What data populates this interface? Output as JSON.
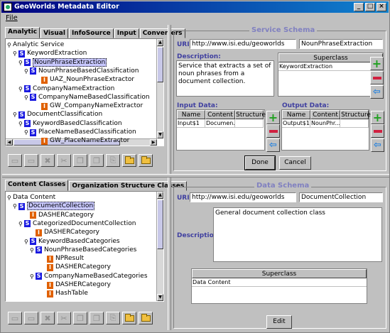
{
  "window": {
    "title": "GeoWorlds Metadata Editor"
  },
  "menu": {
    "file": "File"
  },
  "top_tabs": [
    "Analytic",
    "Visual",
    "InfoSource",
    "Input",
    "Converters"
  ],
  "top_tree": [
    {
      "type": "root",
      "label": "Analytic Service"
    },
    {
      "type": "S",
      "label": "KeywordExtraction"
    },
    {
      "type": "S",
      "label": "NounPhraseExtraction",
      "selected": true
    },
    {
      "type": "S",
      "label": "NounPhraseBasedClassification"
    },
    {
      "type": "I",
      "label": "UAZ_NounPhraseExtractor"
    },
    {
      "type": "S",
      "label": "CompanyNameExtraction"
    },
    {
      "type": "S",
      "label": "CompanyNameBasedClassification"
    },
    {
      "type": "I",
      "label": "GW_CompanyNameExtractor"
    },
    {
      "type": "S",
      "label": "DocumentClassification"
    },
    {
      "type": "S",
      "label": "KeywordBasedClassification"
    },
    {
      "type": "S",
      "label": "PlaceNameBasedClassification"
    },
    {
      "type": "I",
      "label": "GW_PlaceNameExtractor"
    }
  ],
  "bottom_tabs": [
    "Content Classes",
    "Organization Structure Classes"
  ],
  "bottom_tree": [
    {
      "type": "root",
      "label": "Data Content"
    },
    {
      "type": "S",
      "label": "DocumentCollection",
      "selected": true
    },
    {
      "type": "I",
      "label": "DASHERCategory"
    },
    {
      "type": "S",
      "label": "CategorizedDocumentCollection"
    },
    {
      "type": "I",
      "label": "DASHERCategory"
    },
    {
      "type": "S",
      "label": "KeywordBasedCategories"
    },
    {
      "type": "S",
      "label": "NounPhraseBasedCategories"
    },
    {
      "type": "I",
      "label": "NPResult"
    },
    {
      "type": "I",
      "label": "DASHERCategory"
    },
    {
      "type": "S",
      "label": "CompanyNameBasedCategories"
    },
    {
      "type": "I",
      "label": "DASHERCategory"
    },
    {
      "type": "I",
      "label": "HashTable"
    }
  ],
  "service_schema": {
    "title": "Service Schema",
    "uri_label": "URI:",
    "uri_value": "http://www.isi.edu/geoworlds",
    "name_value": "NounPhraseExtraction",
    "description_label": "Description:",
    "description": "Service that extracts a set of noun phrases from a document collection.",
    "superclass_header": "Superclass",
    "superclass_value": "KeywordExtraction",
    "input_label": "Input Data:",
    "output_label": "Output Data:",
    "columns": [
      "Name",
      "Content",
      "Structure"
    ],
    "input_rows": [
      [
        "Input$1",
        "Documen...",
        ""
      ]
    ],
    "output_rows": [
      [
        "Output$1",
        "NounPhr...",
        ""
      ]
    ],
    "done": "Done",
    "cancel": "Cancel"
  },
  "data_schema": {
    "title": "Data Schema",
    "uri_label": "URI:",
    "uri_value": "http://www.isi.edu/geoworlds",
    "name_value": "DocumentCollection",
    "description_label": "Description:",
    "description": "General document collection class",
    "superclass_header": "Superclass",
    "superclass_value": "Data Content",
    "edit": "Edit"
  }
}
